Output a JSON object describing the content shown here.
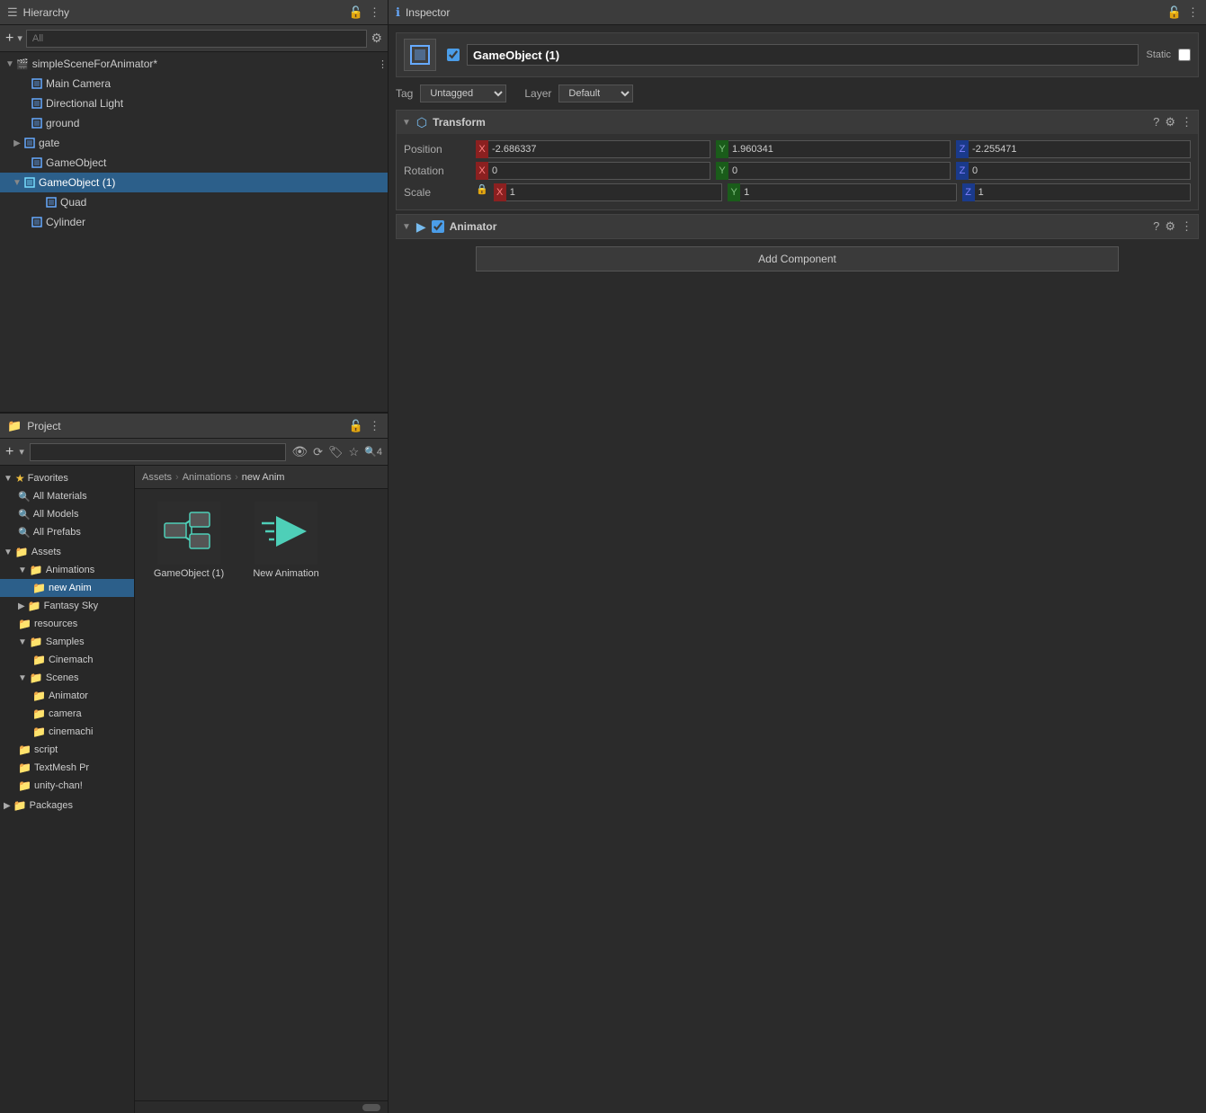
{
  "hierarchy": {
    "title": "Hierarchy",
    "search_placeholder": "All",
    "scene": "simpleSceneForAnimator*",
    "items": [
      {
        "id": "main-camera",
        "label": "Main Camera",
        "depth": 1,
        "icon": "camera",
        "expanded": false,
        "selected": false
      },
      {
        "id": "directional-light",
        "label": "Directional Light",
        "depth": 1,
        "icon": "light",
        "expanded": false,
        "selected": false
      },
      {
        "id": "ground",
        "label": "ground",
        "depth": 1,
        "icon": "cube",
        "expanded": false,
        "selected": false
      },
      {
        "id": "gate",
        "label": "gate",
        "depth": 1,
        "icon": "cube",
        "expanded": false,
        "has_arrow": true,
        "selected": false
      },
      {
        "id": "gameobject",
        "label": "GameObject",
        "depth": 1,
        "icon": "cube",
        "expanded": false,
        "selected": false
      },
      {
        "id": "gameobject1",
        "label": "GameObject (1)",
        "depth": 1,
        "icon": "cube",
        "expanded": true,
        "selected": true
      },
      {
        "id": "quad",
        "label": "Quad",
        "depth": 2,
        "icon": "cube",
        "expanded": false,
        "selected": false
      },
      {
        "id": "cylinder",
        "label": "Cylinder",
        "depth": 1,
        "icon": "cube",
        "expanded": false,
        "selected": false
      }
    ]
  },
  "project": {
    "title": "Project",
    "breadcrumb": [
      "Assets",
      "Animations",
      "new Anim"
    ],
    "sidebar": {
      "sections": [
        {
          "label": "Favorites",
          "icon": "star",
          "items": [
            {
              "label": "All Materials",
              "icon": "search"
            },
            {
              "label": "All Models",
              "icon": "search"
            },
            {
              "label": "All Prefabs",
              "icon": "search"
            }
          ]
        },
        {
          "label": "Assets",
          "icon": "folder",
          "items": [
            {
              "label": "Animations",
              "icon": "folder",
              "expanded": true,
              "children": [
                {
                  "label": "new Anim",
                  "icon": "folder",
                  "selected": true
                }
              ]
            },
            {
              "label": "Fantasy Sky",
              "icon": "folder"
            },
            {
              "label": "resources",
              "icon": "folder"
            },
            {
              "label": "Samples",
              "icon": "folder",
              "expanded": true,
              "children": [
                {
                  "label": "Cinemach",
                  "icon": "folder"
                }
              ]
            },
            {
              "label": "Scenes",
              "icon": "folder",
              "expanded": true,
              "children": [
                {
                  "label": "Animator",
                  "icon": "folder"
                },
                {
                  "label": "camera",
                  "icon": "folder"
                },
                {
                  "label": "cinemachi",
                  "icon": "folder"
                }
              ]
            },
            {
              "label": "script",
              "icon": "folder"
            },
            {
              "label": "TextMesh Pr",
              "icon": "folder"
            },
            {
              "label": "unity-chan!",
              "icon": "folder"
            }
          ]
        },
        {
          "label": "Packages",
          "icon": "folder"
        }
      ]
    },
    "assets": [
      {
        "id": "gameobject1-asset",
        "label": "GameObject (1)",
        "type": "controller"
      },
      {
        "id": "new-animation",
        "label": "New Animation",
        "type": "animation"
      }
    ]
  },
  "inspector": {
    "title": "Inspector",
    "gameobject_name": "GameObject (1)",
    "gameobject_active": true,
    "static_label": "Static",
    "tag_label": "Tag",
    "tag_value": "Untagged",
    "layer_label": "Layer",
    "layer_value": "Default",
    "components": [
      {
        "name": "Transform",
        "icon": "transform",
        "expanded": true,
        "position": {
          "x": "-2.686337",
          "y": "1.960341",
          "z": "-2.255471"
        },
        "rotation": {
          "x": "0",
          "y": "0",
          "z": "0"
        },
        "scale": {
          "x": "1",
          "y": "1",
          "z": "1"
        }
      },
      {
        "name": "Animator",
        "icon": "animator",
        "expanded": true
      }
    ],
    "add_component_label": "Add Component"
  }
}
